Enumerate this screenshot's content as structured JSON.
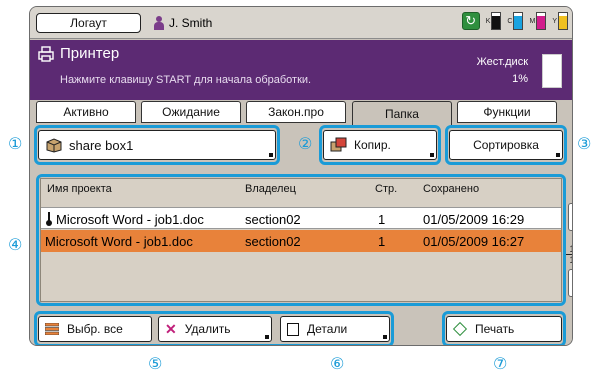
{
  "topbar": {
    "logout_label": "Логаут",
    "user_name": "J. Smith",
    "ink": [
      {
        "letter": "K",
        "color": "#111111",
        "level": 0.8
      },
      {
        "letter": "C",
        "color": "#1aa3e0",
        "level": 0.8
      },
      {
        "letter": "M",
        "color": "#d21c8c",
        "level": 0.8
      },
      {
        "letter": "Y",
        "color": "#f0c020",
        "level": 0.8
      }
    ]
  },
  "header": {
    "title": "Принтер",
    "message": "Нажмите клавишу START для начала обработки.",
    "disk_label": "Жест.диск",
    "disk_percent": "1%",
    "accent": "#5c2a73"
  },
  "tabs": [
    {
      "label": "Активно",
      "active": false
    },
    {
      "label": "Ожидание",
      "active": false
    },
    {
      "label": "Закон.про",
      "active": false
    },
    {
      "label": "Папка",
      "active": true
    },
    {
      "label": "Функции",
      "active": false
    }
  ],
  "folder": {
    "share_box_label": "share box1",
    "copy_label": "Копир.",
    "sort_label": "Сортировка"
  },
  "table": {
    "headers": [
      "Имя проекта",
      "Владелец",
      "Стр.",
      "Сохранено"
    ],
    "rows": [
      {
        "name": "Microsoft Word - job1.doc",
        "owner": "section02",
        "pages": "1",
        "saved": "01/05/2009 16:29",
        "selected": false
      },
      {
        "name": "Microsoft Word - job1.doc",
        "owner": "section02",
        "pages": "1",
        "saved": "01/05/2009 16:27",
        "selected": true
      }
    ],
    "page_current": "1",
    "page_total": "1"
  },
  "actions": {
    "select_all_label": "Выбр. все",
    "delete_label": "Удалить",
    "details_label": "Детали",
    "print_label": "Печать"
  },
  "callouts": [
    "①",
    "②",
    "③",
    "④",
    "⑤",
    "⑥",
    "⑦"
  ],
  "colors": {
    "highlight": "#1a9bd7",
    "selected_row": "#e8823a"
  }
}
